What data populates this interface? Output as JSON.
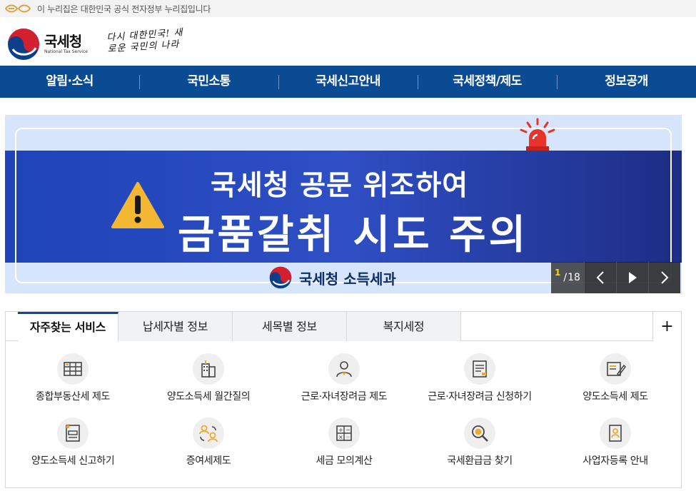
{
  "gov_notice": "이 누리집은 대한민국 공식 전자정부 누리집입니다",
  "logo": {
    "name_ko": "국세청",
    "name_en": "National Tax Service",
    "slogan": "다시 대한민국! 새로운 국민의 나라"
  },
  "gnb": [
    "알림·소식",
    "국민소통",
    "국세신고안내",
    "국세정책/제도",
    "정보공개"
  ],
  "banner": {
    "line1": "국세청 공문 위조하여",
    "line2": "금품갈취 시도 주의",
    "footer": "국세청 소득세과",
    "colors": {
      "band": "#2444b8",
      "bg": "#d6e5fb"
    }
  },
  "slider": {
    "current": "1",
    "separator": "/",
    "total": "18"
  },
  "tabs": {
    "items": [
      "자주찾는 서비스",
      "납세자별 정보",
      "세목별 정보",
      "복지세정"
    ],
    "active": 0,
    "more": "+"
  },
  "services": [
    {
      "label": "종합부동산세 제도",
      "icon": "building-rows-icon"
    },
    {
      "label": "양도소득세 월간질의",
      "icon": "office-building-icon"
    },
    {
      "label": "근로·자녀장려금 제도",
      "icon": "person-icon"
    },
    {
      "label": "근로·자녀장려금 신청하기",
      "icon": "document-icon"
    },
    {
      "label": "양도소득세 제도",
      "icon": "document-pen-icon"
    },
    {
      "label": "양도소득세 신고하기",
      "icon": "form-icon"
    },
    {
      "label": "증여세제도",
      "icon": "people-exchange-icon"
    },
    {
      "label": "세금 모의계산",
      "icon": "calculator-icon"
    },
    {
      "label": "국세환급금 찾기",
      "icon": "magnifier-won-icon"
    },
    {
      "label": "사업자등록 안내",
      "icon": "id-card-icon"
    }
  ],
  "accent": "#0b4b93"
}
